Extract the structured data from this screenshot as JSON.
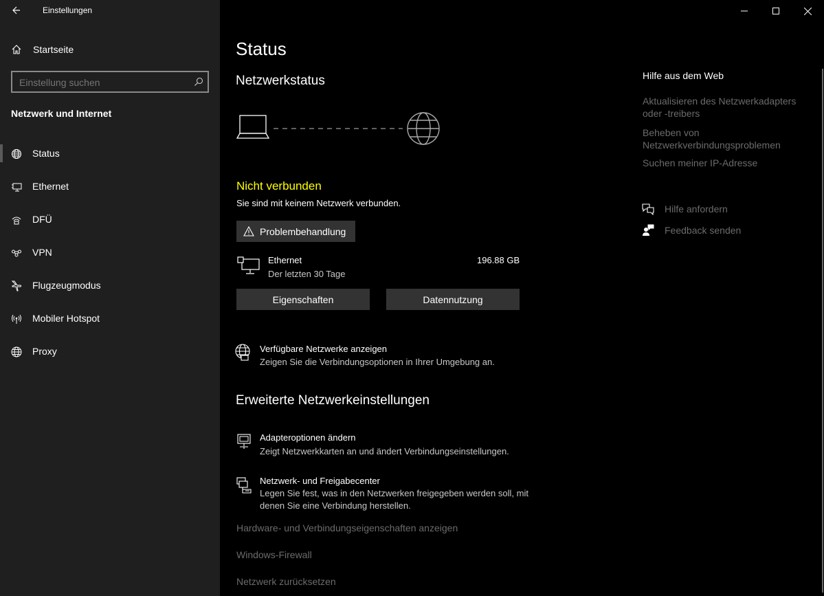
{
  "window": {
    "title": "Einstellungen"
  },
  "sidebar": {
    "home_label": "Startseite",
    "search_placeholder": "Einstellung suchen",
    "section_title": "Netzwerk und Internet",
    "items": [
      {
        "label": "Status",
        "icon": "globe-status-icon"
      },
      {
        "label": "Ethernet",
        "icon": "ethernet-icon"
      },
      {
        "label": "DFÜ",
        "icon": "dialup-icon"
      },
      {
        "label": "VPN",
        "icon": "vpn-icon"
      },
      {
        "label": "Flugzeugmodus",
        "icon": "airplane-icon"
      },
      {
        "label": "Mobiler Hotspot",
        "icon": "hotspot-icon"
      },
      {
        "label": "Proxy",
        "icon": "globe-icon"
      }
    ]
  },
  "main": {
    "page_title": "Status",
    "network_status_title": "Netzwerkstatus",
    "connection_state": "Nicht verbunden",
    "connection_state_color": "#ffff00",
    "connection_message": "Sie sind mit keinem Netzwerk verbunden.",
    "troubleshoot_label": "Problembehandlung",
    "adapter": {
      "name": "Ethernet",
      "period": "Der letzten 30 Tage",
      "usage": "196.88 GB"
    },
    "properties_label": "Eigenschaften",
    "data_usage_label": "Datennutzung",
    "available_networks": {
      "title": "Verfügbare Netzwerke anzeigen",
      "desc": "Zeigen Sie die Verbindungsoptionen in Ihrer Umgebung an."
    },
    "advanced_title": "Erweiterte Netzwerkeinstellungen",
    "adapter_options": {
      "title": "Adapteroptionen ändern",
      "desc": "Zeigt Netzwerkkarten an und ändert Verbindungseinstellungen."
    },
    "sharing_center": {
      "title": "Netzwerk- und Freigabecenter",
      "desc_line1": "Legen Sie fest, was in den Netzwerken freigegeben werden soll, mit",
      "desc_line2": "denen Sie eine Verbindung herstellen."
    },
    "link_hardware": "Hardware- und Verbindungseigenschaften anzeigen",
    "link_firewall": "Windows-Firewall",
    "link_reset": "Netzwerk zurücksetzen"
  },
  "help": {
    "title": "Hilfe aus dem Web",
    "link1_line1": "Aktualisieren des Netzwerkadapters",
    "link1_line2": "oder -treibers",
    "link2_line1": "Beheben von",
    "link2_line2": "Netzwerkverbindungsproblemen",
    "link3": "Suchen meiner IP-Adresse",
    "get_help": "Hilfe anfordern",
    "feedback": "Feedback senden"
  }
}
